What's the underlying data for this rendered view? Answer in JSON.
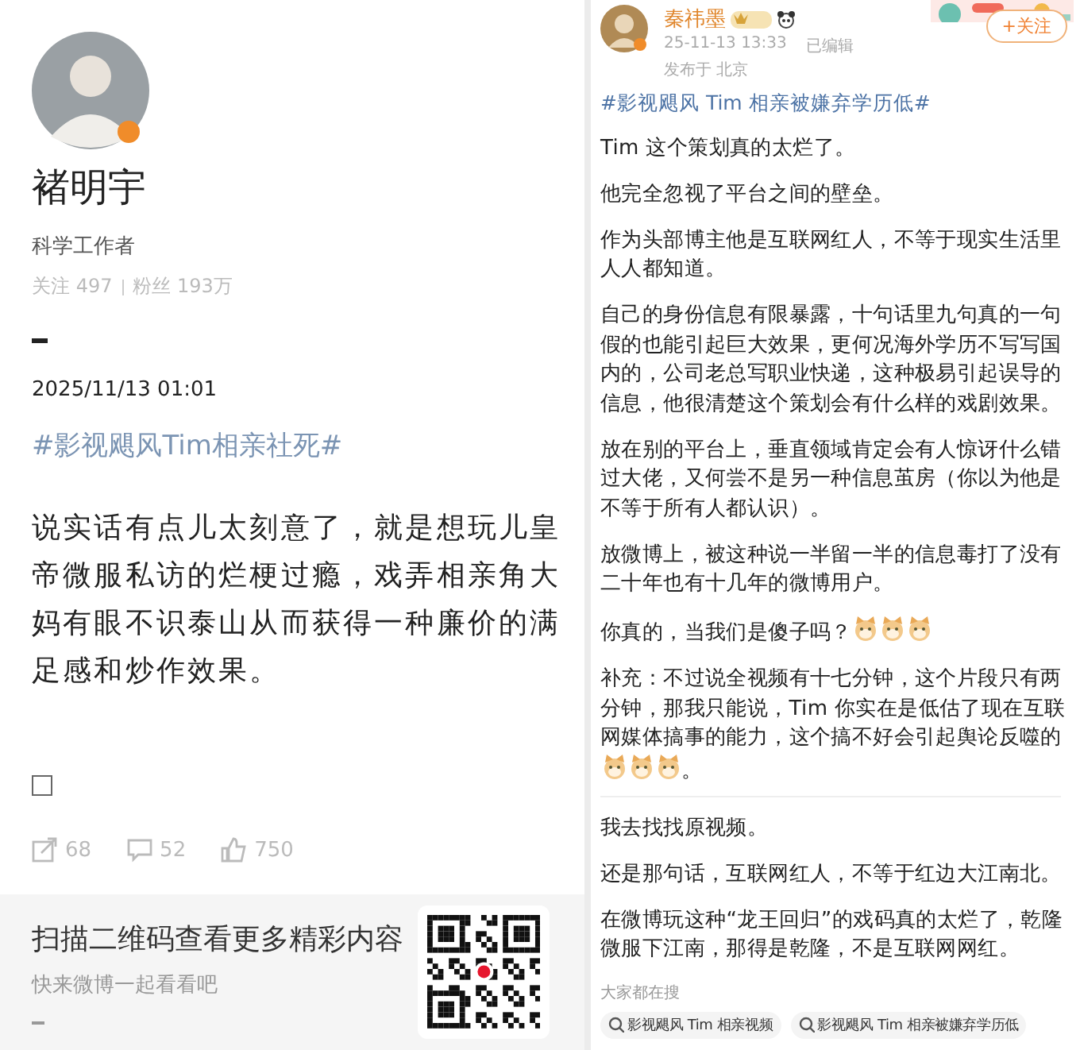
{
  "left_post": {
    "author": {
      "name": "褚明宇",
      "bio": "科学工作者",
      "following": "关注 497",
      "followers": "粉丝 193万"
    },
    "date": "2025/11/13 01:01",
    "topic": "#影视飓风Tim相亲社死#",
    "body": "说实话有点儿太刻意了，就是想玩儿皇帝微服私访的烂梗过瘾，戏弄相亲角大妈有眼不识泰山从而获得一种廉价的满足感和炒作效果。",
    "actions": [
      {
        "kind": "repost",
        "count": "68"
      },
      {
        "kind": "comment",
        "count": "52"
      },
      {
        "kind": "like",
        "count": "750"
      }
    ],
    "footer": {
      "title": "扫描二维码查看更多精彩内容",
      "subtitle": "快来微博一起看看吧"
    }
  },
  "right_post": {
    "author": {
      "name": "秦祎墨",
      "time": "25-11-13 13:33",
      "edited": "已编辑",
      "location": "发布于 北京"
    },
    "follow_button": "+关注",
    "topic": "#影视飓风 Tim 相亲被嫌弃学历低#",
    "paragraphs": [
      {
        "kind": "paragraph",
        "text": "Tim 这个策划真的太烂了。"
      },
      {
        "kind": "paragraph",
        "text": "他完全忽视了平台之间的壁垒。"
      },
      {
        "kind": "paragraph",
        "text": "作为头部博主他是互联网红人，不等于现实生活里人人都知道。"
      },
      {
        "kind": "paragraph",
        "text": "自己的身份信息有限暴露，十句话里九句真的一句假的也能引起巨大效果，更何况海外学历不写写国内的，公司老总写职业快递，这种极易引起误导的信息，他很清楚这个策划会有什么样的戏剧效果。"
      },
      {
        "kind": "paragraph",
        "text": "放在别的平台上，垂直领域肯定会有人惊讶什么错过大佬，又何尝不是另一种信息茧房（你以为他是不等于所有人都认识）。"
      },
      {
        "kind": "paragraph",
        "text": "放微博上，被这种说一半留一半的信息毒打了没有二十年也有十几年的微博用户。"
      },
      {
        "kind": "paragraph",
        "parts": [
          {
            "kind": "text",
            "text": "你真的，当我们是傻子吗？"
          },
          {
            "kind": "cat"
          },
          {
            "kind": "cat"
          },
          {
            "kind": "cat"
          }
        ]
      },
      {
        "kind": "paragraph",
        "parts": [
          {
            "kind": "text",
            "text": "补充：不过说全视频有十七分钟，这个片段只有两分钟，那我只能说，Tim 你实在是低估了现在互联网媒体搞事的能力，这个搞不好会引起舆论反噬的"
          },
          {
            "kind": "cat"
          },
          {
            "kind": "cat"
          },
          {
            "kind": "cat"
          },
          {
            "kind": "text",
            "text": "。"
          }
        ]
      },
      {
        "kind": "divider"
      },
      {
        "kind": "paragraph",
        "text": "我去找找原视频。"
      },
      {
        "kind": "paragraph",
        "text": "还是那句话，互联网红人，不等于红边大江南北。"
      },
      {
        "kind": "paragraph",
        "text": "在微博玩这种“龙王回归”的戏码真的太烂了，乾隆微服下江南，那得是乾隆，不是互联网网红。"
      }
    ],
    "search": {
      "label": "大家都在搜",
      "chips": [
        "影视飓风 Tim 相亲视频",
        "影视飓风 Tim 相亲被嫌弃学历低"
      ]
    }
  }
}
